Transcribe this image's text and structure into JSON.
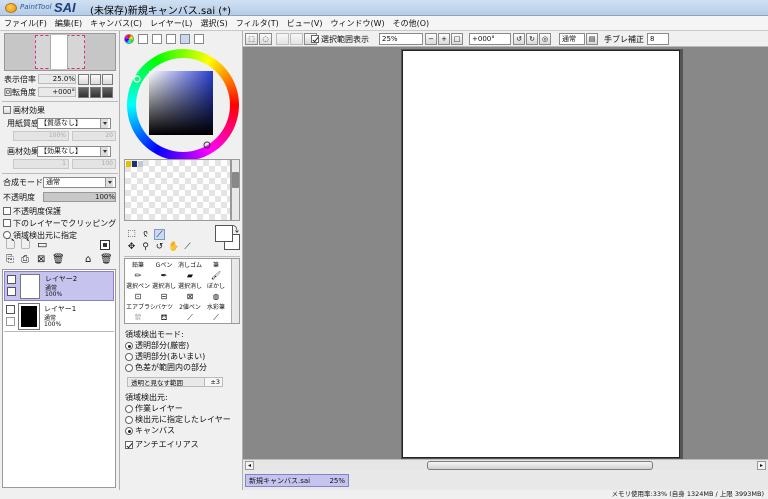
{
  "window": {
    "logo_text": "PaintTool",
    "logo_brand": "SAI",
    "title": "(未保存)新規キャンバス.sai (*)"
  },
  "menu": [
    "ファイル(F)",
    "編集(E)",
    "キャンバス(C)",
    "レイヤー(L)",
    "選択(S)",
    "フィルタ(T)",
    "ビュー(V)",
    "ウィンドウ(W)",
    "その他(O)"
  ],
  "navigator": {
    "zoom_label": "表示倍率",
    "zoom_value": "25.0%",
    "angle_label": "回転角度",
    "angle_value": "+000°"
  },
  "paper_effects": {
    "section_label": "画材効果",
    "texture_label": "用紙質感",
    "texture_value": "【質感なし】",
    "texture_scale": "100%",
    "texture_strength": "20",
    "effect_label": "画材効果",
    "effect_value": "【効果なし】",
    "effect_width": "1",
    "effect_strength": "100"
  },
  "layer_props": {
    "blend_label": "合成モード",
    "blend_value": "通常",
    "opacity_label": "不透明度",
    "opacity_value": "100%",
    "protect_opacity": "不透明度保護",
    "clip_lower": "下のレイヤーでクリッピング",
    "selection_source": "領域検出元に指定"
  },
  "layers": [
    {
      "name": "レイヤー2",
      "mode": "通常",
      "opacity": "100%",
      "selected": true
    },
    {
      "name": "レイヤー1",
      "mode": "通常",
      "opacity": "100%",
      "selected": false
    }
  ],
  "brushes": [
    {
      "name": "鉛筆",
      "icon": "pencil-icon"
    },
    {
      "name": "Gペン",
      "icon": "pen-icon"
    },
    {
      "name": "消しゴム",
      "icon": "eraser-icon"
    },
    {
      "name": "筆",
      "icon": "brush-icon"
    },
    {
      "name": "選択ペン",
      "icon": "selection-pen-icon"
    },
    {
      "name": "選択消し",
      "icon": "selection-eraser-icon"
    },
    {
      "name": "選択消し",
      "icon": "selection-erase2-icon"
    },
    {
      "name": "ぼかし",
      "icon": "blur-icon"
    },
    {
      "name": "エアブラシ",
      "icon": "airbrush-icon"
    },
    {
      "name": "バケツ",
      "icon": "bucket-icon"
    },
    {
      "name": "2値ペン",
      "icon": "binary-pen-icon"
    },
    {
      "name": "水彩筆",
      "icon": "watercolor-icon"
    }
  ],
  "fill_options": {
    "mode_label": "領域検出モード:",
    "mode_options": [
      "透明部分(厳密)",
      "透明部分(あいまい)",
      "色差が範囲内の部分"
    ],
    "mode_selected": 0,
    "range_label": "透明と見なす範囲",
    "range_value": "±3",
    "source_label": "領域検出元:",
    "source_options": [
      "作業レイヤー",
      "検出元に指定したレイヤー",
      "キャンバス"
    ],
    "source_selected": 2,
    "antialias_label": "アンチエイリアス",
    "antialias_checked": true
  },
  "toolbar": {
    "show_selection_label": "選択範囲表示",
    "show_selection_checked": true,
    "zoom_value": "25%",
    "angle_value": "+000°",
    "blend_value": "通常",
    "stabilizer_label": "手ブレ補正",
    "stabilizer_value": "8"
  },
  "status": {
    "doc_tab_name": "新規キャンバス.sai",
    "doc_tab_zoom": "25%",
    "memory": "メモリ使用率:33% (自身 1324MB / 上限 3993MB)"
  },
  "colors": {
    "selected_layer": "#c6c4ee",
    "canvas_bg": "#888888",
    "nav_frame": "#e0308a"
  }
}
